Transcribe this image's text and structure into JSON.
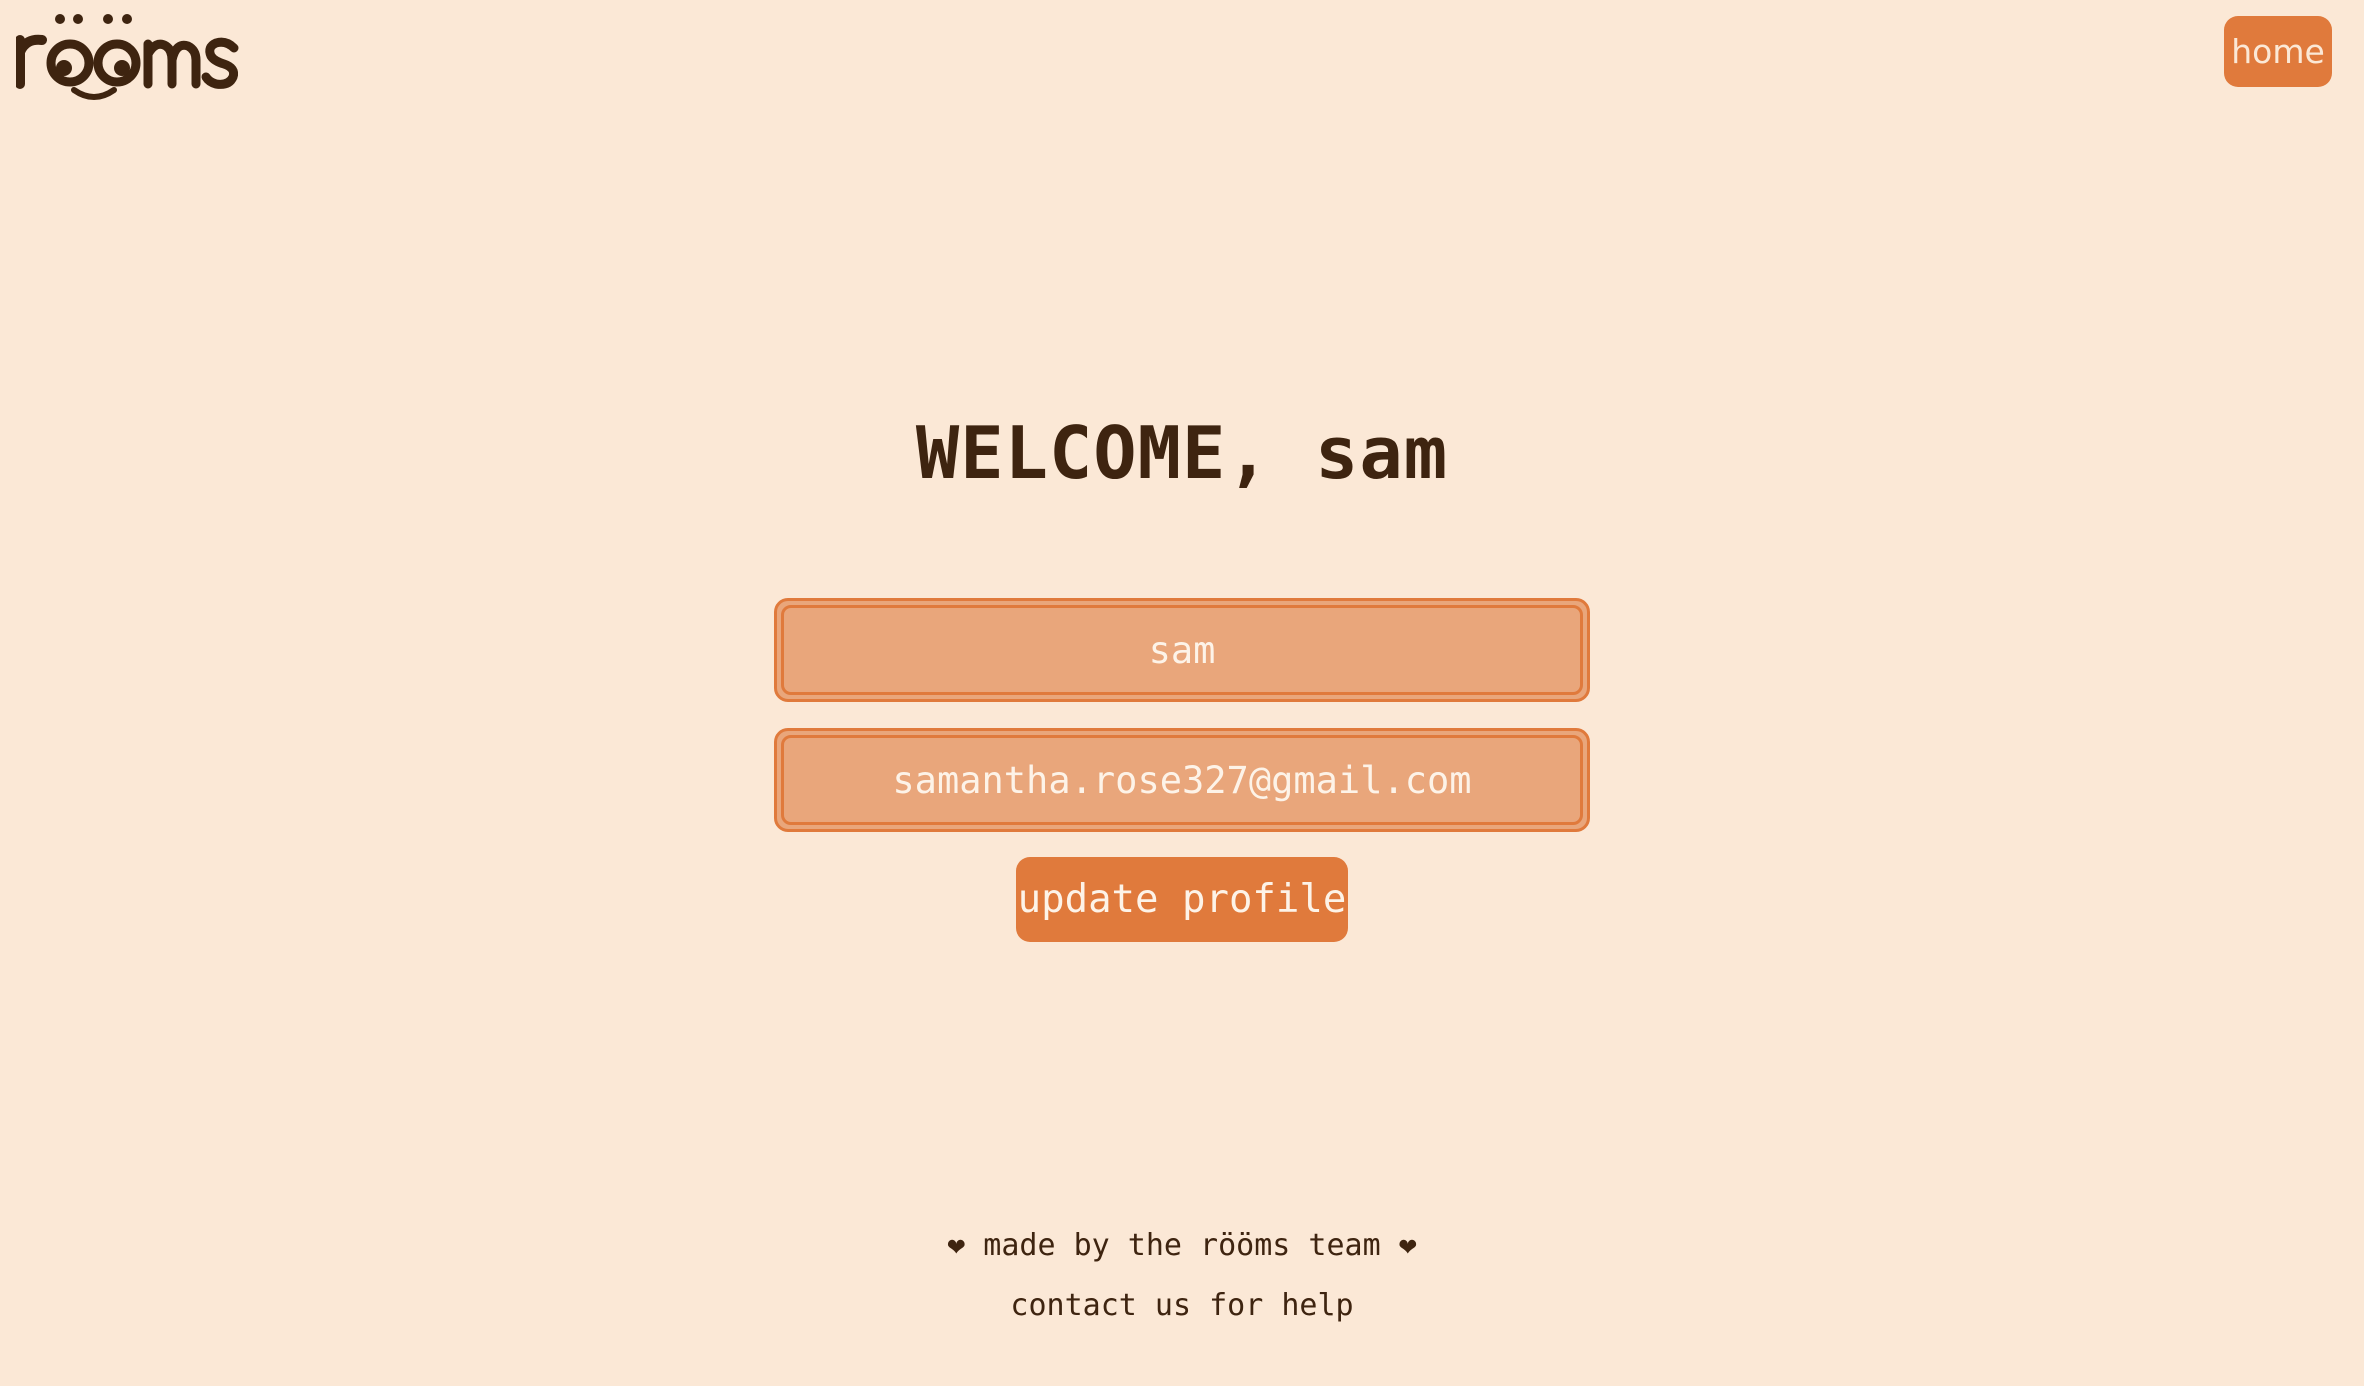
{
  "header": {
    "logo_text": "rööms",
    "home_label": "home"
  },
  "main": {
    "welcome_text": "WELCOME, sam",
    "name_field_value": "sam",
    "email_field_value": "samantha.rose327@gmail.com",
    "update_button_label": "update profile"
  },
  "footer": {
    "made_by": "❤ made by the rööms team ❤",
    "contact": "contact us for help"
  },
  "colors": {
    "background": "#fbe8d6",
    "accent": "#e07a3c",
    "field_fill": "#e9a67b",
    "text_dark": "#3e2410",
    "text_light": "#fdf3e8"
  }
}
